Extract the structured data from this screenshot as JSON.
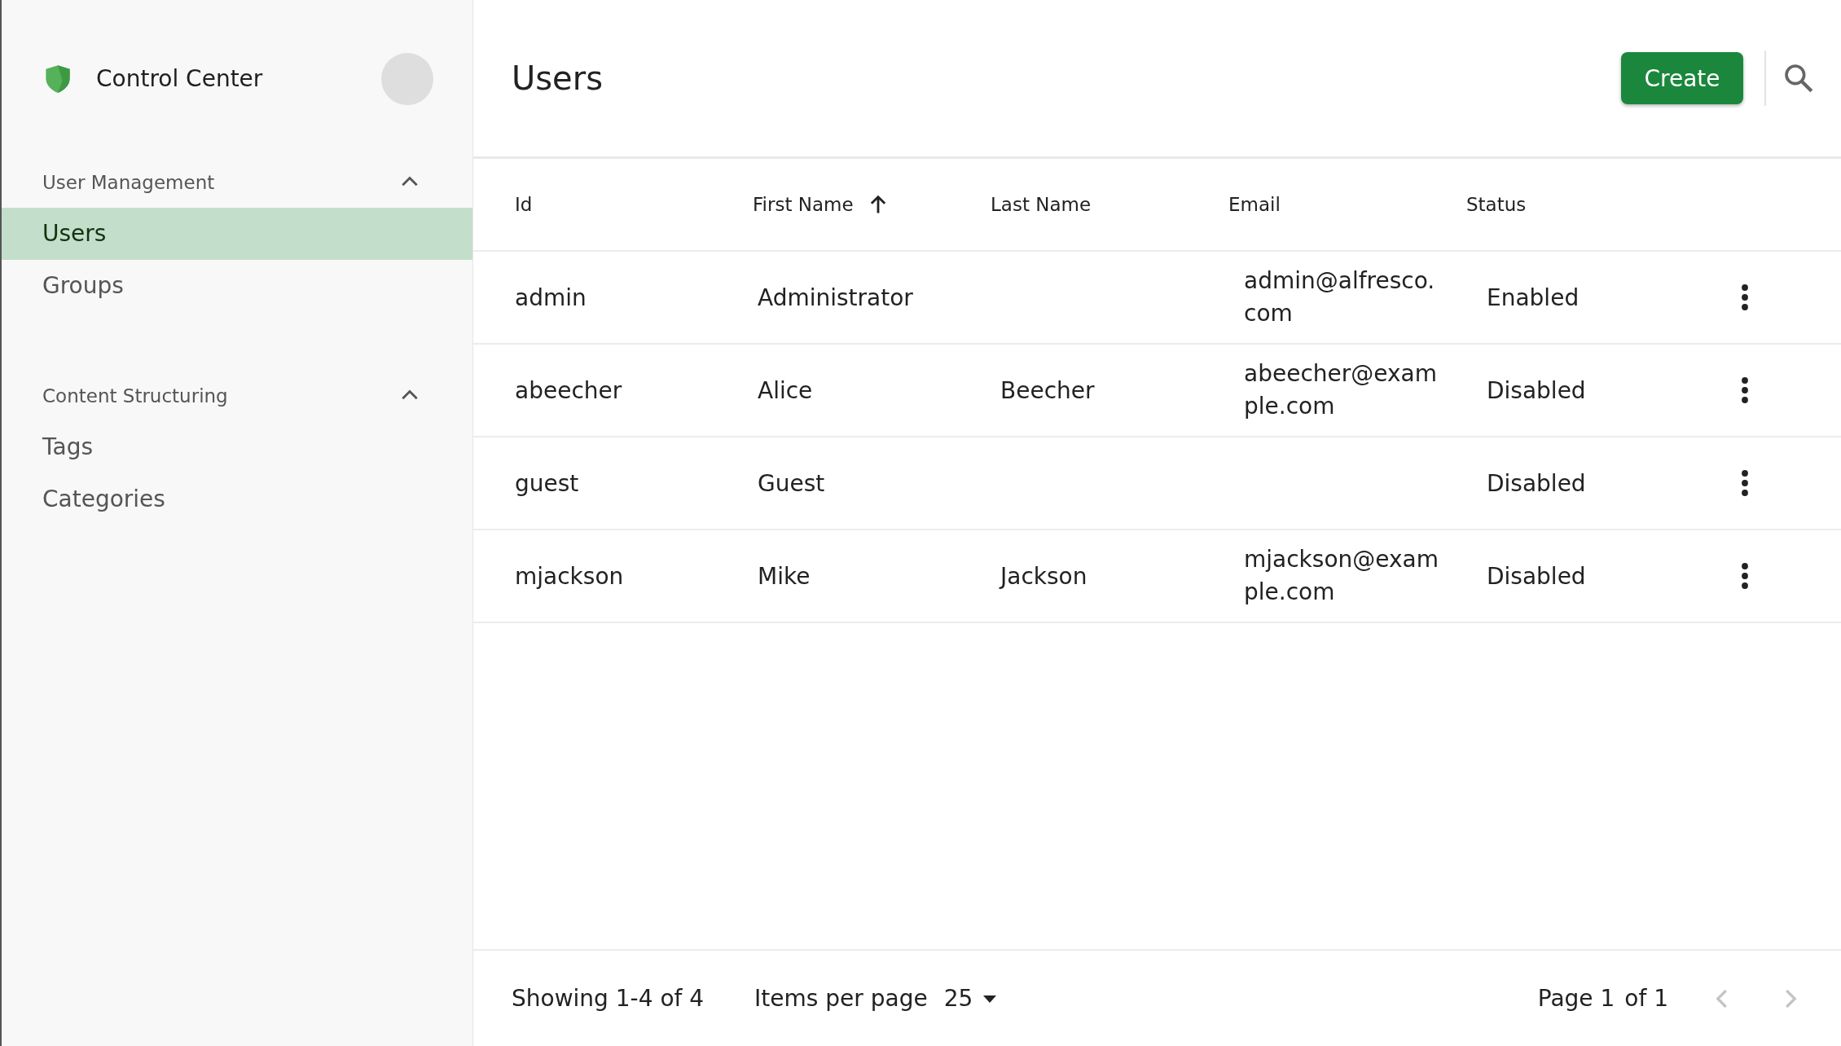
{
  "sidebar": {
    "app_title": "Control Center",
    "sections": [
      {
        "title": "User Management",
        "expanded": true,
        "items": [
          {
            "label": "Users",
            "selected": true
          },
          {
            "label": "Groups",
            "selected": false
          }
        ]
      },
      {
        "title": "Content Structuring",
        "expanded": true,
        "items": [
          {
            "label": "Tags",
            "selected": false
          },
          {
            "label": "Categories",
            "selected": false
          }
        ]
      }
    ]
  },
  "header": {
    "title": "Users",
    "create_button": "Create"
  },
  "table": {
    "columns": [
      {
        "label": "Id",
        "sorted": false
      },
      {
        "label": "First Name",
        "sorted": true
      },
      {
        "label": "Last Name",
        "sorted": false
      },
      {
        "label": "Email",
        "sorted": false
      },
      {
        "label": "Status",
        "sorted": false
      }
    ],
    "rows": [
      {
        "cells": [
          "admin",
          "Administrator",
          "",
          "admin@alfresco.com",
          "Enabled"
        ]
      },
      {
        "cells": [
          "abeecher",
          "Alice",
          "Beecher",
          "abeecher@example.com",
          "Disabled"
        ]
      },
      {
        "cells": [
          "guest",
          "Guest",
          "",
          "",
          "Disabled"
        ]
      },
      {
        "cells": [
          "mjackson",
          "Mike",
          "Jackson",
          "mjackson@example.com",
          "Disabled"
        ]
      }
    ]
  },
  "footer": {
    "summary": "Showing 1-4 of 4",
    "items_per_page_label": "Items per page",
    "items_per_page": "25",
    "page_label": "Page 1",
    "page_total": "of 1",
    "previous_disabled": true,
    "next_disabled": true
  }
}
